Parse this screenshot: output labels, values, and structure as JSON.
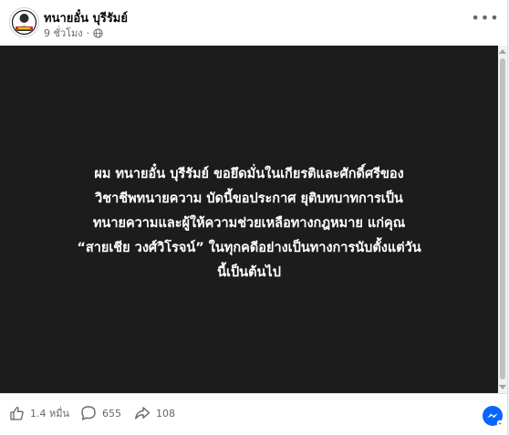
{
  "post": {
    "page_name": "ทนายอั๋น บุรีรัมย์",
    "time": "9 ชั่วโมง",
    "separator": "·",
    "more_icon": "ellipsis-icon",
    "privacy_icon": "globe-icon"
  },
  "media": {
    "lines": [
      "ผม ทนายอั๋น บุรีรัมย์ ขอยึดมั่นในเกียรติและศักดิ์ศรีของ",
      "วิชาชีพทนายความ บัดนี้ขอประกาศ ยุติบทบาทการเป็น",
      "ทนายความและผู้ให้ความช่วยเหลือทางกฎหมาย แก่คุณ",
      "“สายเชีย วงศ์วิโรจน์” ในทุกคดีอย่างเป็นทางการนับตั้งแต่วัน",
      "นี้เป็นต้นไป"
    ],
    "background": "#1c1c1c"
  },
  "stats": {
    "likes": "1.4 หมื่น",
    "comments": "655",
    "shares": "108"
  },
  "colors": {
    "text_secondary": "#65676b",
    "messenger_blue": "#0866ff"
  }
}
